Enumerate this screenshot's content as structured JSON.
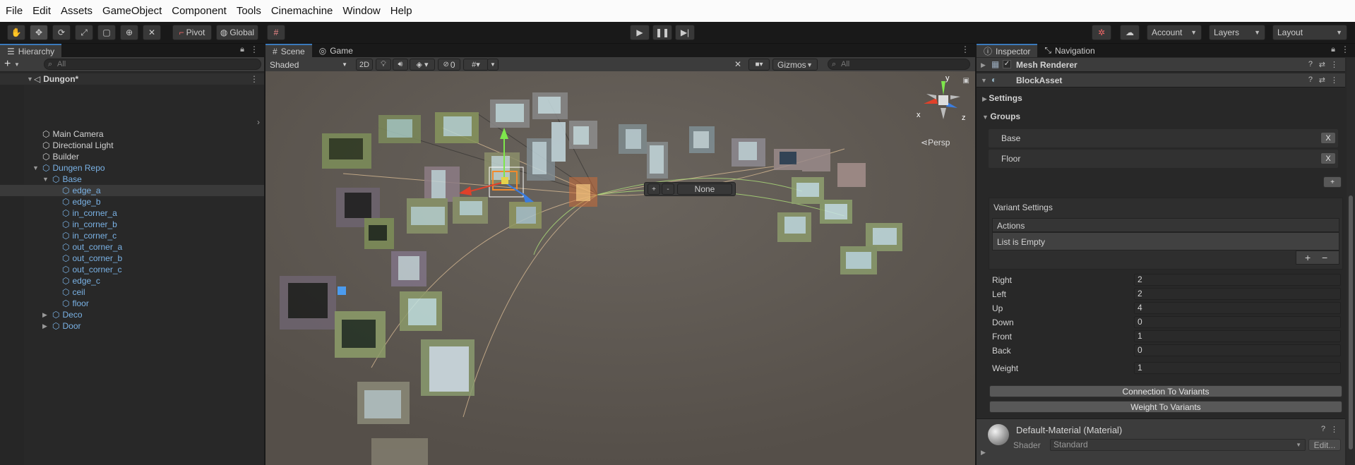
{
  "menu": [
    "File",
    "Edit",
    "Assets",
    "GameObject",
    "Component",
    "Tools",
    "Cinemachine",
    "Window",
    "Help"
  ],
  "toolbar": {
    "pivot": "Pivot",
    "global": "Global",
    "account": "Account",
    "layers": "Layers",
    "layout": "Layout"
  },
  "hierarchy": {
    "tab": "Hierarchy",
    "search_placeholder": "All",
    "scene": "Dungon*",
    "items": [
      {
        "label": "Main Camera",
        "depth": 1,
        "blue": false
      },
      {
        "label": "Directional Light",
        "depth": 1,
        "blue": false
      },
      {
        "label": "Builder",
        "depth": 1,
        "blue": false
      },
      {
        "label": "Dungen Repo",
        "depth": 1,
        "blue": true,
        "fold": "open"
      },
      {
        "label": "Base",
        "depth": 2,
        "blue": true,
        "fold": "open"
      },
      {
        "label": "edge_a",
        "depth": 3,
        "blue": true,
        "selected": true
      },
      {
        "label": "edge_b",
        "depth": 3,
        "blue": true
      },
      {
        "label": "in_corner_a",
        "depth": 3,
        "blue": true
      },
      {
        "label": "in_corner_b",
        "depth": 3,
        "blue": true
      },
      {
        "label": "in_corner_c",
        "depth": 3,
        "blue": true
      },
      {
        "label": "out_corner_a",
        "depth": 3,
        "blue": true
      },
      {
        "label": "out_corner_b",
        "depth": 3,
        "blue": true
      },
      {
        "label": "out_corner_c",
        "depth": 3,
        "blue": true
      },
      {
        "label": "edge_c",
        "depth": 3,
        "blue": true
      },
      {
        "label": "ceil",
        "depth": 3,
        "blue": true
      },
      {
        "label": "floor",
        "depth": 3,
        "blue": true
      },
      {
        "label": "Deco",
        "depth": 2,
        "blue": true,
        "fold": "closed"
      },
      {
        "label": "Door",
        "depth": 2,
        "blue": true,
        "fold": "closed"
      }
    ]
  },
  "scene_view": {
    "tab_scene": "Scene",
    "tab_game": "Game",
    "shading": "Shaded",
    "mode_2d": "2D",
    "hidden_count": "0",
    "gizmos": "Gizmos",
    "search_placeholder": "All",
    "persp": "Persp",
    "overlay_value": "None",
    "overlay_plus": "+",
    "overlay_minus": "-",
    "axis_x": "x",
    "axis_y": "y",
    "axis_z": "z"
  },
  "inspector": {
    "tab_inspector": "Inspector",
    "tab_navigation": "Navigation",
    "mesh_renderer": "Mesh Renderer",
    "block_asset": "BlockAsset",
    "settings": "Settings",
    "groups": "Groups",
    "group_items": [
      "Base",
      "Floor"
    ],
    "remove_label": "X",
    "add_label": "+",
    "variant_settings": "Variant Settings",
    "actions": "Actions",
    "list_empty": "List is Empty",
    "list_plus": "+",
    "list_minus": "−",
    "fields": [
      {
        "label": "Right",
        "value": "2"
      },
      {
        "label": "Left",
        "value": "2"
      },
      {
        "label": "Up",
        "value": "4"
      },
      {
        "label": "Down",
        "value": "0"
      },
      {
        "label": "Front",
        "value": "1"
      },
      {
        "label": "Back",
        "value": "0"
      }
    ],
    "weight_label": "Weight",
    "weight_value": "1",
    "btn_connection": "Connection To Variants",
    "btn_weight": "Weight To Variants",
    "material": "Default-Material (Material)",
    "shader_label": "Shader",
    "shader_value": "Standard",
    "edit": "Edit..."
  },
  "colors": {
    "accent": "#3a79bb",
    "prefab_blue": "#7ab2e5",
    "scene_bg": "#5e5953"
  }
}
